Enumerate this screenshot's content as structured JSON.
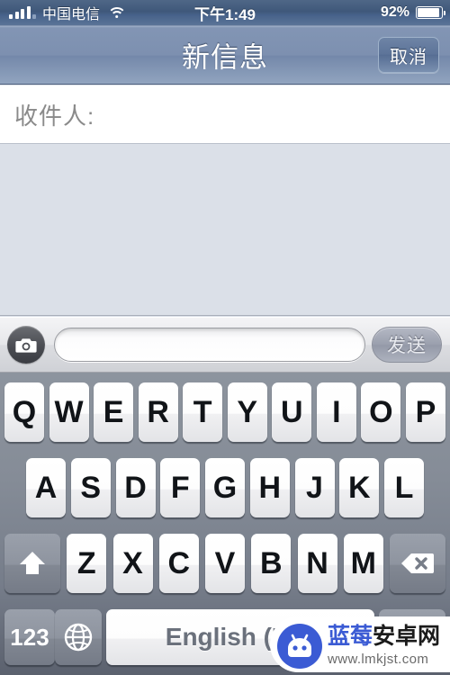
{
  "status_bar": {
    "carrier": "中国电信",
    "signal_icon": "signal-bars-icon",
    "wifi_icon": "wifi-icon",
    "time": "下午1:49",
    "battery_percent": "92%",
    "battery_icon": "battery-icon",
    "battery_level": 92
  },
  "nav_bar": {
    "title": "新信息",
    "cancel_label": "取消"
  },
  "recipient": {
    "label": "收件人:",
    "value": "",
    "placeholder": ""
  },
  "compose": {
    "camera_icon": "camera-icon",
    "message_value": "",
    "message_placeholder": "",
    "send_label": "发送"
  },
  "keyboard": {
    "row1": [
      "Q",
      "W",
      "E",
      "R",
      "T",
      "Y",
      "U",
      "I",
      "O",
      "P"
    ],
    "row2": [
      "A",
      "S",
      "D",
      "F",
      "G",
      "H",
      "J",
      "K",
      "L"
    ],
    "row3_letters": [
      "Z",
      "X",
      "C",
      "V",
      "B",
      "N",
      "M"
    ],
    "shift_icon": "shift-arrow-icon",
    "delete_icon": "backspace-delete-icon",
    "numeric_label": "123",
    "globe_icon": "globe-keyboard-switch-icon",
    "space_label": "English (US)",
    "return_label": ""
  },
  "watermark": {
    "logo_icon": "android-robot-logo-icon",
    "title_part1": "蓝莓",
    "title_part2": "安卓网",
    "url": "www.lmkjst.com"
  },
  "colors": {
    "status_bar": "#47628a",
    "nav_bar": "#7d90b0",
    "body_bg": "#dbe0e8",
    "keyboard_bg": "#858c97",
    "key_face": "#ffffff",
    "accent_blue": "#3b5bd4"
  }
}
